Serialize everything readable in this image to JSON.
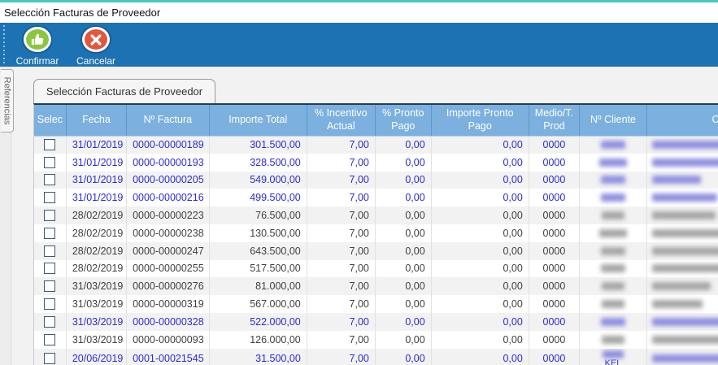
{
  "window": {
    "title": "Selección Facturas de Proveedor"
  },
  "toolbar": {
    "confirm_label": "Confirmar",
    "cancel_label": "Cancelar"
  },
  "sidebar": {
    "tab_label": "Referencias"
  },
  "main": {
    "tab_label": "Selección Facturas de Proveedor"
  },
  "colors": {
    "top_accent": "#42cbc3",
    "toolbar_blue": "#1d72b4",
    "header_blue": "#7cb0de",
    "confirm_green": "#8cc63f",
    "cancel_red": "#e2573d",
    "row_link_blue": "#2b2bd4",
    "row_text_dark": "#3f3f3f"
  },
  "table": {
    "columns": [
      "Selec",
      "Fecha",
      "Nº Factura",
      "Importe Total",
      "% Incentivo Actual",
      "% Pronto Pago",
      "Importe Pronto Pago",
      "Medio/T. Prod",
      "Nº Cliente",
      "Cliente Titular"
    ],
    "rows": [
      {
        "checked": false,
        "fecha": "31/01/2019",
        "factura": "0000-00000189",
        "importe_total": "301.500,00",
        "incentivo": "7,00",
        "pronto_pago": "0,00",
        "importe_pronto": "0,00",
        "medio": "0000",
        "highlight": true,
        "n_cliente_redacted": true,
        "titular_redacted": true,
        "n_cliente_blur": 30,
        "titular_blur": 95
      },
      {
        "checked": false,
        "fecha": "31/01/2019",
        "factura": "0000-00000193",
        "importe_total": "328.500,00",
        "incentivo": "7,00",
        "pronto_pago": "0,00",
        "importe_pronto": "0,00",
        "medio": "0000",
        "highlight": true,
        "n_cliente_redacted": true,
        "titular_redacted": true,
        "n_cliente_blur": 34,
        "titular_blur": 150
      },
      {
        "checked": false,
        "fecha": "31/01/2019",
        "factura": "0000-00000205",
        "importe_total": "549.000,00",
        "incentivo": "7,00",
        "pronto_pago": "0,00",
        "importe_pronto": "0,00",
        "medio": "0000",
        "highlight": true,
        "n_cliente_redacted": true,
        "titular_redacted": true,
        "n_cliente_blur": 30,
        "titular_blur": 60
      },
      {
        "checked": false,
        "fecha": "31/01/2019",
        "factura": "0000-00000216",
        "importe_total": "499.500,00",
        "incentivo": "7,00",
        "pronto_pago": "0,00",
        "importe_pronto": "0,00",
        "medio": "0000",
        "highlight": true,
        "n_cliente_redacted": true,
        "titular_redacted": true,
        "n_cliente_blur": 30,
        "titular_blur": 80
      },
      {
        "checked": false,
        "fecha": "28/02/2019",
        "factura": "0000-00000223",
        "importe_total": "76.500,00",
        "incentivo": "7,00",
        "pronto_pago": "0,00",
        "importe_pronto": "0,00",
        "medio": "0000",
        "highlight": false,
        "n_cliente_redacted": true,
        "titular_redacted": true,
        "n_cliente_blur": 28,
        "titular_blur": 78
      },
      {
        "checked": false,
        "fecha": "28/02/2019",
        "factura": "0000-00000238",
        "importe_total": "130.500,00",
        "incentivo": "7,00",
        "pronto_pago": "0,00",
        "importe_pronto": "0,00",
        "medio": "0000",
        "highlight": false,
        "n_cliente_redacted": true,
        "titular_redacted": true,
        "n_cliente_blur": 34,
        "titular_blur": 115
      },
      {
        "checked": false,
        "fecha": "28/02/2019",
        "factura": "0000-00000247",
        "importe_total": "643.500,00",
        "incentivo": "7,00",
        "pronto_pago": "0,00",
        "importe_pronto": "0,00",
        "medio": "0000",
        "highlight": false,
        "n_cliente_redacted": true,
        "titular_redacted": true,
        "n_cliente_blur": 30,
        "titular_blur": 85
      },
      {
        "checked": false,
        "fecha": "28/02/2019",
        "factura": "0000-00000255",
        "importe_total": "517.500,00",
        "incentivo": "7,00",
        "pronto_pago": "0,00",
        "importe_pronto": "0,00",
        "medio": "0000",
        "highlight": false,
        "n_cliente_redacted": true,
        "titular_redacted": true,
        "n_cliente_blur": 30,
        "titular_blur": 100
      },
      {
        "checked": false,
        "fecha": "31/03/2019",
        "factura": "0000-00000276",
        "importe_total": "81.000,00",
        "incentivo": "7,00",
        "pronto_pago": "0,00",
        "importe_pronto": "0,00",
        "medio": "0000",
        "highlight": false,
        "n_cliente_redacted": true,
        "titular_redacted": true,
        "n_cliente_blur": 28,
        "titular_blur": 72
      },
      {
        "checked": false,
        "fecha": "31/03/2019",
        "factura": "0000-00000319",
        "importe_total": "567.000,00",
        "incentivo": "7,00",
        "pronto_pago": "0,00",
        "importe_pronto": "0,00",
        "medio": "0000",
        "highlight": false,
        "n_cliente_redacted": true,
        "titular_redacted": true,
        "n_cliente_blur": 28,
        "titular_blur": 62
      },
      {
        "checked": false,
        "fecha": "31/03/2019",
        "factura": "0000-00000328",
        "importe_total": "522.000,00",
        "incentivo": "7,00",
        "pronto_pago": "0,00",
        "importe_pronto": "0,00",
        "medio": "0000",
        "highlight": true,
        "n_cliente_redacted": true,
        "titular_redacted": true,
        "n_cliente_blur": 30,
        "titular_blur": 88
      },
      {
        "checked": false,
        "fecha": "31/03/2019",
        "factura": "0000-00000093",
        "importe_total": "126.000,00",
        "incentivo": "7,00",
        "pronto_pago": "0,00",
        "importe_pronto": "0,00",
        "medio": "0000",
        "highlight": false,
        "n_cliente_redacted": true,
        "titular_redacted": true,
        "n_cliente_blur": 28,
        "titular_blur": 112
      },
      {
        "checked": false,
        "fecha": "20/06/2019",
        "factura": "0001-00021545",
        "importe_total": "31.500,00",
        "incentivo": "7,00",
        "pronto_pago": "0,00",
        "importe_pronto": "0,00",
        "medio": "0000",
        "highlight": true,
        "n_cliente_redacted": true,
        "titular_redacted": true,
        "n_cliente_blur": 26,
        "titular_blur": 92,
        "n_cliente_text": "KEL"
      }
    ]
  }
}
